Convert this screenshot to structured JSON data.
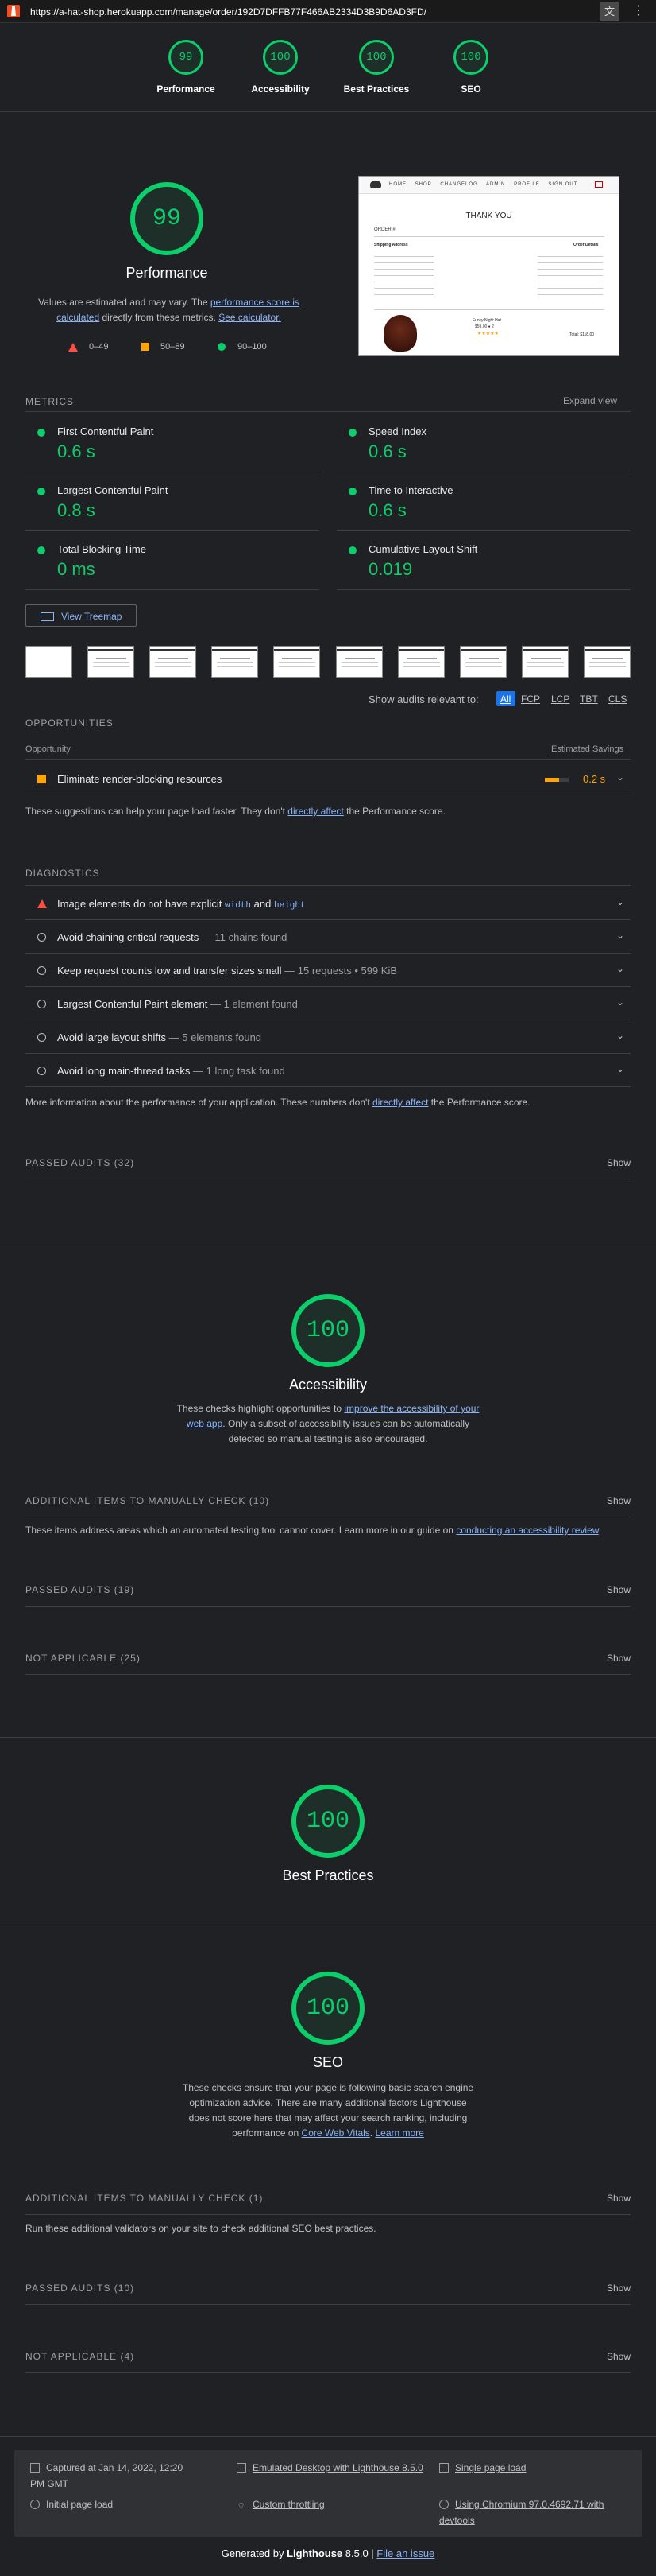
{
  "browser": {
    "url": "https://a-hat-shop.herokuapp.com/manage/order/192D7DFFB77F466AB2334D3B9D6AD3FD/",
    "translate_icon": "translate-icon",
    "menu_icon": "kebab-menu-icon"
  },
  "header_scores": [
    {
      "score": "99",
      "label": "Performance"
    },
    {
      "score": "100",
      "label": "Accessibility"
    },
    {
      "score": "100",
      "label": "Best Practices"
    },
    {
      "score": "100",
      "label": "SEO"
    }
  ],
  "performance": {
    "score": "99",
    "title": "Performance",
    "desc_pre": "Values are estimated and may vary. The ",
    "desc_link1": "performance score is calculated",
    "desc_mid": " directly from these metrics. ",
    "desc_link2": "See calculator.",
    "legend": [
      {
        "range": "0–49",
        "color": "#ff4e42"
      },
      {
        "range": "50–89",
        "color": "#ffa400"
      },
      {
        "range": "90–100",
        "color": "#0cce6b"
      }
    ]
  },
  "preview": {
    "nav": [
      "HOME",
      "SHOP",
      "CHANGELOG",
      "ADMIN",
      "PROFILE",
      "SIGN OUT"
    ],
    "title": "THANK YOU",
    "order_label": "ORDER #",
    "shipping_label": "Shipping Address",
    "order_details_label": "Order Details",
    "product_name": "Funky Night Hat",
    "product_price": "$59.00 ● 2",
    "stars": "★★★★★",
    "total": "Total: $118.00"
  },
  "metrics": {
    "heading": "METRICS",
    "expand": "Expand view",
    "items": [
      {
        "name": "First Contentful Paint",
        "value": "0.6 s"
      },
      {
        "name": "Speed Index",
        "value": "0.6 s"
      },
      {
        "name": "Largest Contentful Paint",
        "value": "0.8 s"
      },
      {
        "name": "Time to Interactive",
        "value": "0.6 s"
      },
      {
        "name": "Total Blocking Time",
        "value": "0 ms"
      },
      {
        "name": "Cumulative Layout Shift",
        "value": "0.019"
      }
    ]
  },
  "treemap": {
    "label": "View Treemap"
  },
  "filter": {
    "label": "Show audits relevant to:",
    "options": [
      "All",
      "FCP",
      "LCP",
      "TBT",
      "CLS"
    ]
  },
  "opportunities": {
    "heading": "OPPORTUNITIES",
    "col_left": "Opportunity",
    "col_right": "Estimated Savings",
    "item": "Eliminate render-blocking resources",
    "savings": "0.2 s",
    "savings_fraction": 0.6,
    "note_pre": "These suggestions can help your page load faster. They don't ",
    "note_link": "directly affect",
    "note_post": " the Performance score."
  },
  "diagnostics": {
    "heading": "DIAGNOSTICS",
    "img_title": "Image elements do not have explicit",
    "img_code1": "width",
    "img_and": "and",
    "img_code2": "height",
    "items": [
      {
        "title": "Avoid chaining critical requests",
        "sub": "— 11 chains found"
      },
      {
        "title": "Keep request counts low and transfer sizes small",
        "sub": "— 15 requests • 599 KiB"
      },
      {
        "title": "Largest Contentful Paint element",
        "sub": "— 1 element found"
      },
      {
        "title": "Avoid large layout shifts",
        "sub": "— 5 elements found"
      },
      {
        "title": "Avoid long main-thread tasks",
        "sub": "— 1 long task found"
      }
    ],
    "note_pre": "More information about the performance of your application. These numbers don't ",
    "note_link": "directly affect",
    "note_post": " the Performance score."
  },
  "perf_passed": {
    "label": "PASSED AUDITS (32)",
    "show": "Show"
  },
  "accessibility": {
    "score": "100",
    "title": "Accessibility",
    "desc_pre": "These checks highlight opportunities to ",
    "desc_link": "improve the accessibility of your web app",
    "desc_post": ". Only a subset of accessibility issues can be automatically detected so manual testing is also encouraged.",
    "manual": "ADDITIONAL ITEMS TO MANUALLY CHECK (10)",
    "manual_note_pre": "These items address areas which an automated testing tool cannot cover. Learn more in our guide on ",
    "manual_note_link": "conducting an accessibility review",
    "manual_note_post": ".",
    "passed": "PASSED AUDITS (19)",
    "na": "NOT APPLICABLE (25)",
    "show": "Show"
  },
  "best_practices": {
    "score": "100",
    "title": "Best Practices"
  },
  "seo": {
    "score": "100",
    "title": "SEO",
    "desc": "These checks ensure that your page is following basic search engine optimization advice. There are many additional factors Lighthouse does not score here that may affect your search ranking, including performance on ",
    "desc_link1": "Core Web Vitals",
    "desc_link2": "Learn more",
    "manual": "ADDITIONAL ITEMS TO MANUALLY CHECK (1)",
    "manual_note": "Run these additional validators on your site to check additional SEO best practices.",
    "passed": "PASSED AUDITS (10)",
    "na": "NOT APPLICABLE (4)",
    "show": "Show"
  },
  "footer": {
    "captured": "Captured at Jan 14, 2022, 12:20 PM GMT",
    "initial": "Initial page load",
    "emulated": "Emulated Desktop with Lighthouse 8.5.0",
    "throttling": "Custom throttling",
    "single": "Single page load",
    "chromium": "Using Chromium 97.0.4692.71 with devtools",
    "generated_pre": "Generated by ",
    "generated_brand": "Lighthouse",
    "generated_version": " 8.5.0 | ",
    "generated_link": "File an issue"
  }
}
